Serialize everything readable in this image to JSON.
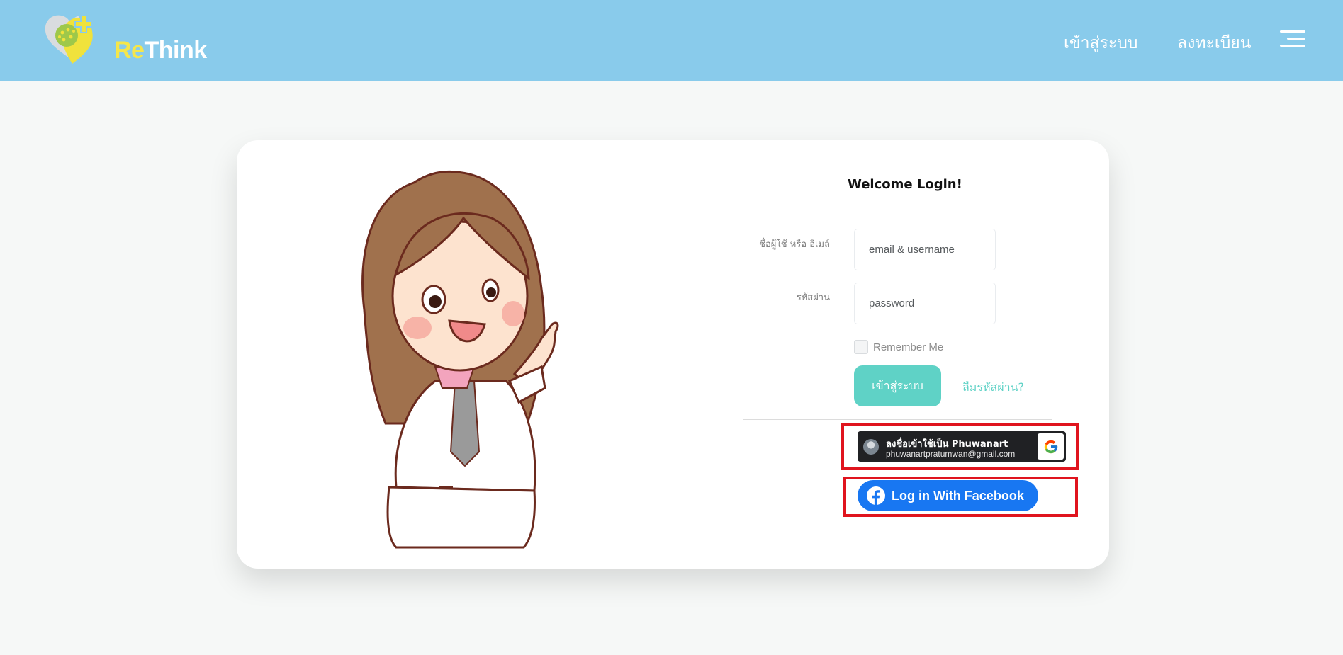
{
  "navbar": {
    "brand": {
      "part1": "Re",
      "part2": "Think"
    },
    "links": {
      "login": "เข้าสู่ระบบ",
      "register": "ลงทะเบียน"
    },
    "menu_icon": "hamburger-menu-icon"
  },
  "login_form": {
    "title": "Welcome Login!",
    "username": {
      "label": "ชื่อผู้ใช้ หรือ อีเมล์",
      "placeholder": "email & username",
      "value": ""
    },
    "password": {
      "label": "รหัสผ่าน",
      "placeholder": "password",
      "value": ""
    },
    "remember_me": {
      "label": "Remember Me",
      "checked": false
    },
    "submit_label": "เข้าสู่ระบบ",
    "forgot_label": "ลืมรหัสผ่าน?"
  },
  "social_login": {
    "google": {
      "line1": "ลงชื่อเข้าใช้เป็น Phuwanart",
      "email": "phuwanartpratumwan@gmail.com",
      "icon": "google-g-icon"
    },
    "facebook": {
      "label": "Log in With Facebook",
      "icon": "facebook-icon"
    }
  },
  "colors": {
    "navbar_bg": "#89cbeb",
    "accent_teal": "#5fd2c6",
    "facebook_blue": "#1877f2",
    "google_dark": "#202124",
    "highlight_red": "#e0141e",
    "brand_yellow": "#f5e64b"
  }
}
